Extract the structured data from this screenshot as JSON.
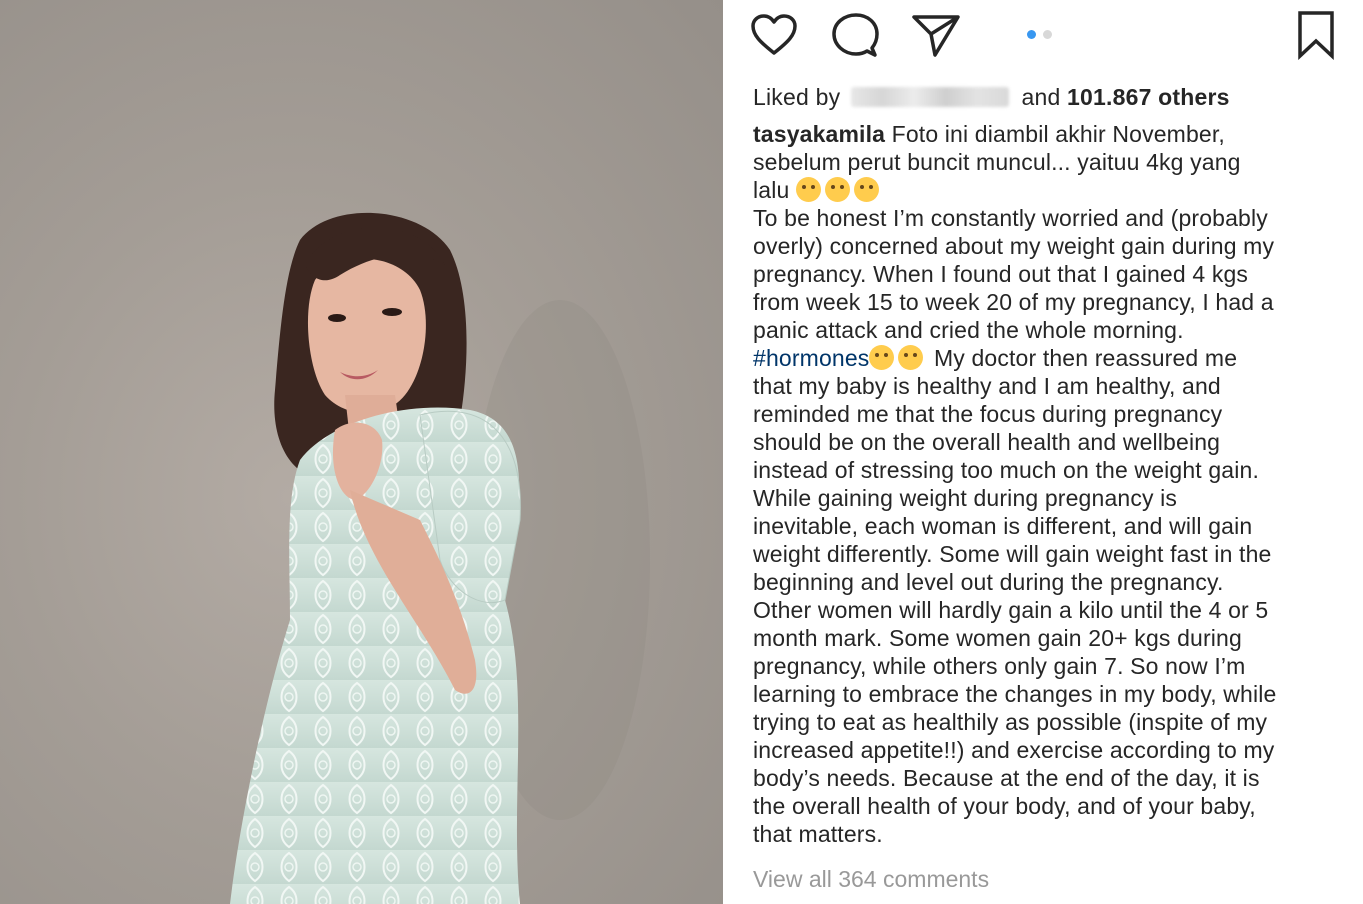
{
  "post": {
    "actions": {
      "like_icon": "heart-icon",
      "comment_icon": "comment-icon",
      "share_icon": "send-icon",
      "save_icon": "bookmark-icon",
      "carousel_pages": 2,
      "carousel_active": 1,
      "accent_color": "#3897f0"
    },
    "likes": {
      "prefix": "Liked by",
      "middle": "and",
      "count": "101.867 others"
    },
    "caption": {
      "username": "tasyakamila",
      "lines": [
        " Foto ini diambil akhir November,",
        "sebelum perut buncit muncul... yaituu 4kg yang",
        "lalu",
        "To be honest I’m constantly worried and (probably",
        "overly) concerned about my weight gain during my",
        "pregnancy. When I found out that I gained 4 kgs",
        "from week 15 to week 20 of my pregnancy, I had a",
        "panic attack and cried the whole morning.",
        "#hormones",
        " My doctor then reassured me",
        "that my baby is healthy and I am healthy, and",
        "reminded me that the focus during pregnancy",
        "should be on the overall health and wellbeing",
        "instead of stressing too much on the weight gain.",
        "While gaining weight during pregnancy is",
        "inevitable, each woman is different, and will gain",
        "weight differently. Some will gain weight fast in the",
        "beginning and level out during the pregnancy.",
        "Other women will hardly gain a kilo until the 4 or 5",
        "month mark. Some women gain 20+ kgs during",
        "pregnancy, while others only gain 7. So now I’m",
        "learning to embrace the changes in my body, while",
        "trying to eat as healthily as possible (inspite of my",
        "increased appetite!!) and exercise according to my",
        "body’s needs. Because at the end of the day, it is",
        "the overall health of your body, and of your baby,",
        "that matters."
      ]
    },
    "view_comments": "View all 364 comments"
  }
}
